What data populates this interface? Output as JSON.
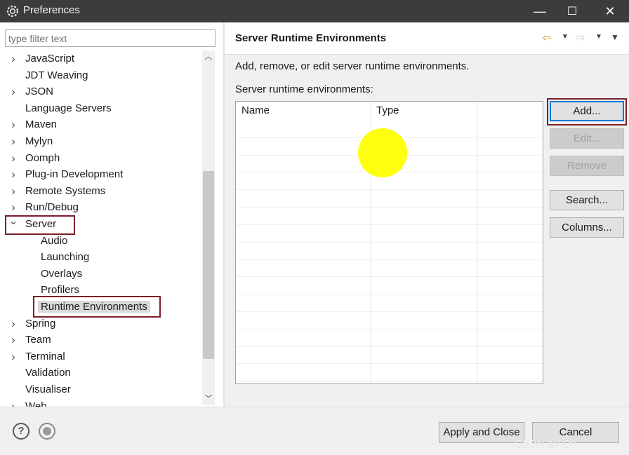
{
  "window": {
    "title": "Preferences",
    "minimize_glyph": "—",
    "maximize_glyph": "☐",
    "close_glyph": "✕"
  },
  "filter": {
    "placeholder": "type filter text",
    "value": ""
  },
  "tree": {
    "items": [
      {
        "label": "JavaScript",
        "expandable": true,
        "level": 0
      },
      {
        "label": "JDT Weaving",
        "expandable": false,
        "level": 0
      },
      {
        "label": "JSON",
        "expandable": true,
        "level": 0
      },
      {
        "label": "Language Servers",
        "expandable": false,
        "level": 0
      },
      {
        "label": "Maven",
        "expandable": true,
        "level": 0
      },
      {
        "label": "Mylyn",
        "expandable": true,
        "level": 0
      },
      {
        "label": "Oomph",
        "expandable": true,
        "level": 0
      },
      {
        "label": "Plug-in Development",
        "expandable": true,
        "level": 0
      },
      {
        "label": "Remote Systems",
        "expandable": true,
        "level": 0
      },
      {
        "label": "Run/Debug",
        "expandable": true,
        "level": 0
      },
      {
        "label": "Server",
        "expandable": true,
        "expanded": true,
        "level": 0
      },
      {
        "label": "Audio",
        "expandable": false,
        "level": 1
      },
      {
        "label": "Launching",
        "expandable": false,
        "level": 1
      },
      {
        "label": "Overlays",
        "expandable": false,
        "level": 1
      },
      {
        "label": "Profilers",
        "expandable": false,
        "level": 1
      },
      {
        "label": "Runtime Environments",
        "expandable": false,
        "level": 1,
        "selected": true
      },
      {
        "label": "Spring",
        "expandable": true,
        "level": 0
      },
      {
        "label": "Team",
        "expandable": true,
        "level": 0
      },
      {
        "label": "Terminal",
        "expandable": true,
        "level": 0
      },
      {
        "label": "Validation",
        "expandable": false,
        "level": 0
      },
      {
        "label": "Visualiser",
        "expandable": false,
        "level": 0
      },
      {
        "label": "Web",
        "expandable": true,
        "level": 0
      }
    ]
  },
  "page": {
    "title": "Server Runtime Environments",
    "description": "Add, remove, or edit server runtime environments.",
    "list_label": "Server runtime environments:",
    "columns": [
      "Name",
      "Type"
    ],
    "buttons": {
      "add": "Add...",
      "edit": "Edit...",
      "remove": "Remove",
      "search": "Search...",
      "columns": "Columns..."
    }
  },
  "footer": {
    "apply_close": "Apply and Close",
    "cancel": "Cancel",
    "help_glyph": "?"
  },
  "watermark": "CSDN @^O^",
  "colors": {
    "highlight_box": "#7b1f2a",
    "cursor_highlight": "#ffff00",
    "default_button_border": "#0078d7"
  }
}
